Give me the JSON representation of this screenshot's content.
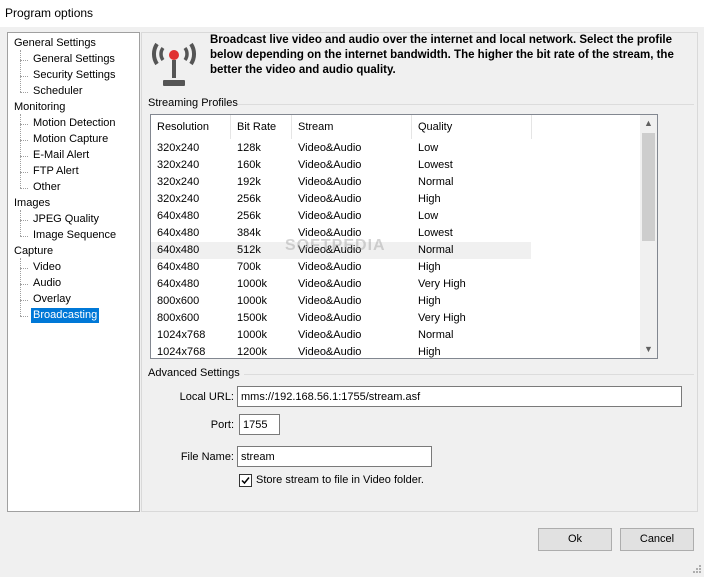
{
  "window": {
    "title": "Program options"
  },
  "tree": {
    "items": [
      {
        "label": "General Settings",
        "level": 0
      },
      {
        "label": "General Settings",
        "level": 1
      },
      {
        "label": "Security Settings",
        "level": 1
      },
      {
        "label": "Scheduler",
        "level": 1
      },
      {
        "label": "Monitoring",
        "level": 0
      },
      {
        "label": "Motion Detection",
        "level": 1
      },
      {
        "label": "Motion Capture",
        "level": 1
      },
      {
        "label": "E-Mail Alert",
        "level": 1
      },
      {
        "label": "FTP Alert",
        "level": 1
      },
      {
        "label": "Other",
        "level": 1
      },
      {
        "label": "Images",
        "level": 0
      },
      {
        "label": "JPEG Quality",
        "level": 1
      },
      {
        "label": "Image Sequence",
        "level": 1
      },
      {
        "label": "Capture",
        "level": 0
      },
      {
        "label": "Video",
        "level": 1
      },
      {
        "label": "Audio",
        "level": 1
      },
      {
        "label": "Overlay",
        "level": 1
      },
      {
        "label": "Broadcasting",
        "level": 1,
        "selected": true
      }
    ]
  },
  "header": {
    "icon": "antenna-icon",
    "description": "Broadcast live video and audio over the internet and local network. Select the profile below depending on the internet bandwidth. The higher the bit rate of the stream, the better the video and audio quality."
  },
  "profiles": {
    "group_label": "Streaming Profiles",
    "columns": [
      "Resolution",
      "Bit Rate",
      "Stream",
      "Quality"
    ],
    "rows": [
      [
        "320x240",
        "128k",
        "Video&Audio",
        "Low"
      ],
      [
        "320x240",
        "160k",
        "Video&Audio",
        "Lowest"
      ],
      [
        "320x240",
        "192k",
        "Video&Audio",
        "Normal"
      ],
      [
        "320x240",
        "256k",
        "Video&Audio",
        "High"
      ],
      [
        "640x480",
        "256k",
        "Video&Audio",
        "Low"
      ],
      [
        "640x480",
        "384k",
        "Video&Audio",
        "Lowest"
      ],
      [
        "640x480",
        "512k",
        "Video&Audio",
        "Normal"
      ],
      [
        "640x480",
        "700k",
        "Video&Audio",
        "High"
      ],
      [
        "640x480",
        "1000k",
        "Video&Audio",
        "Very High"
      ],
      [
        "800x600",
        "1000k",
        "Video&Audio",
        "High"
      ],
      [
        "800x600",
        "1500k",
        "Video&Audio",
        "Very High"
      ],
      [
        "1024x768",
        "1000k",
        "Video&Audio",
        "Normal"
      ],
      [
        "1024x768",
        "1200k",
        "Video&Audio",
        "High"
      ]
    ],
    "highlighted_row": 6,
    "watermark": "SOFTPEDIA"
  },
  "advanced": {
    "group_label": "Advanced Settings",
    "local_url_label": "Local URL:",
    "local_url_value": "mms://192.168.56.1:1755/stream.asf",
    "port_label": "Port:",
    "port_value": "1755",
    "file_name_label": "File Name:",
    "file_name_value": "stream",
    "store_label": "Store stream to file in Video folder.",
    "store_checked": true
  },
  "buttons": {
    "ok": "Ok",
    "cancel": "Cancel"
  }
}
